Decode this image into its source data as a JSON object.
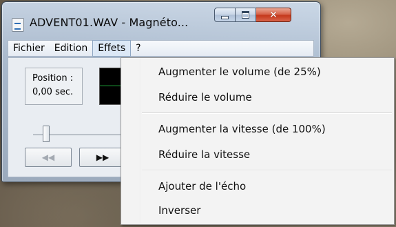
{
  "window": {
    "title": "ADVENT01.WAV - Magnéto...",
    "app_icon": "sound-file-icon",
    "caption_buttons": {
      "minimize_icon": "minimize-icon",
      "maximize_icon": "maximize-icon",
      "close_icon": "close-icon",
      "close_glyph": "✕"
    }
  },
  "menubar": {
    "items": [
      "Fichier",
      "Edition",
      "Effets",
      "?"
    ],
    "open_item": "Effets"
  },
  "main": {
    "position_label": "Position :",
    "position_value": "0,00 sec.",
    "rewind_glyph": "◀◀",
    "forward_glyph": "▶▶"
  },
  "effects_menu": {
    "items": [
      "Augmenter le volume (de 25%)",
      "Réduire le volume",
      "Augmenter la vitesse (de 100%)",
      "Réduire la vitesse",
      "Ajouter de l'écho",
      "Inverser"
    ]
  },
  "colors": {
    "waveform": "#1fae3c",
    "close_button": "#c5391c",
    "menu_highlight": "#dce8f6"
  }
}
